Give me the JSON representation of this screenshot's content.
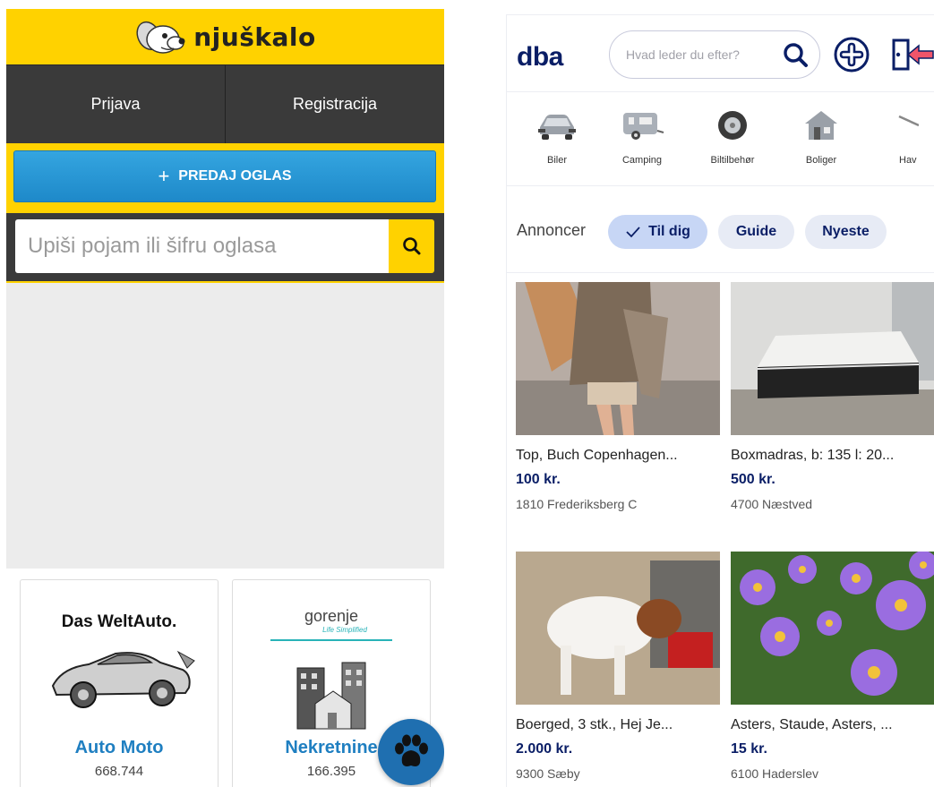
{
  "njuskalo": {
    "logo_text": "njuškalo",
    "nav": [
      "Prijava",
      "Registracija"
    ],
    "post_button": "PREDAJ OGLAS",
    "search_placeholder": "Upiši pojam ili šifru oglasa",
    "categories": [
      {
        "brand": "Das WeltAuto.",
        "name": "Auto Moto",
        "count": "668.744"
      },
      {
        "brand": "gorenje",
        "tagline": "Life Simplified",
        "name": "Nekretnine",
        "count": "166.395"
      }
    ],
    "colors": {
      "yellow": "#ffd200",
      "dark": "#3a3a3a",
      "blue": "#1f7fc1"
    }
  },
  "dba": {
    "logo": "dba",
    "search_placeholder": "Hvad leder du efter?",
    "categories": [
      "Biler",
      "Camping",
      "Biltilbehør",
      "Boliger",
      "Hav"
    ],
    "tabs_label": "Annoncer",
    "tabs": [
      "Til dig",
      "Guide",
      "Nyeste"
    ],
    "active_tab": "Til dig",
    "listings": [
      {
        "title": "Top, Buch Copenhagen...",
        "price": "100 kr.",
        "location": "1810 Frederiksberg C"
      },
      {
        "title": "Boxmadras, b: 135 l: 20...",
        "price": "500 kr.",
        "location": "4700 Næstved"
      },
      {
        "title": "Boerged, 3 stk., Hej Je...",
        "price": "2.000 kr.",
        "location": "9300 Sæby"
      },
      {
        "title": "Asters, Staude, Asters, ...",
        "price": "15 kr.",
        "location": "6100 Haderslev"
      }
    ],
    "colors": {
      "navy": "#0a1e66",
      "chip": "#e7ebf5",
      "chip_active": "#c7d6f5"
    }
  }
}
